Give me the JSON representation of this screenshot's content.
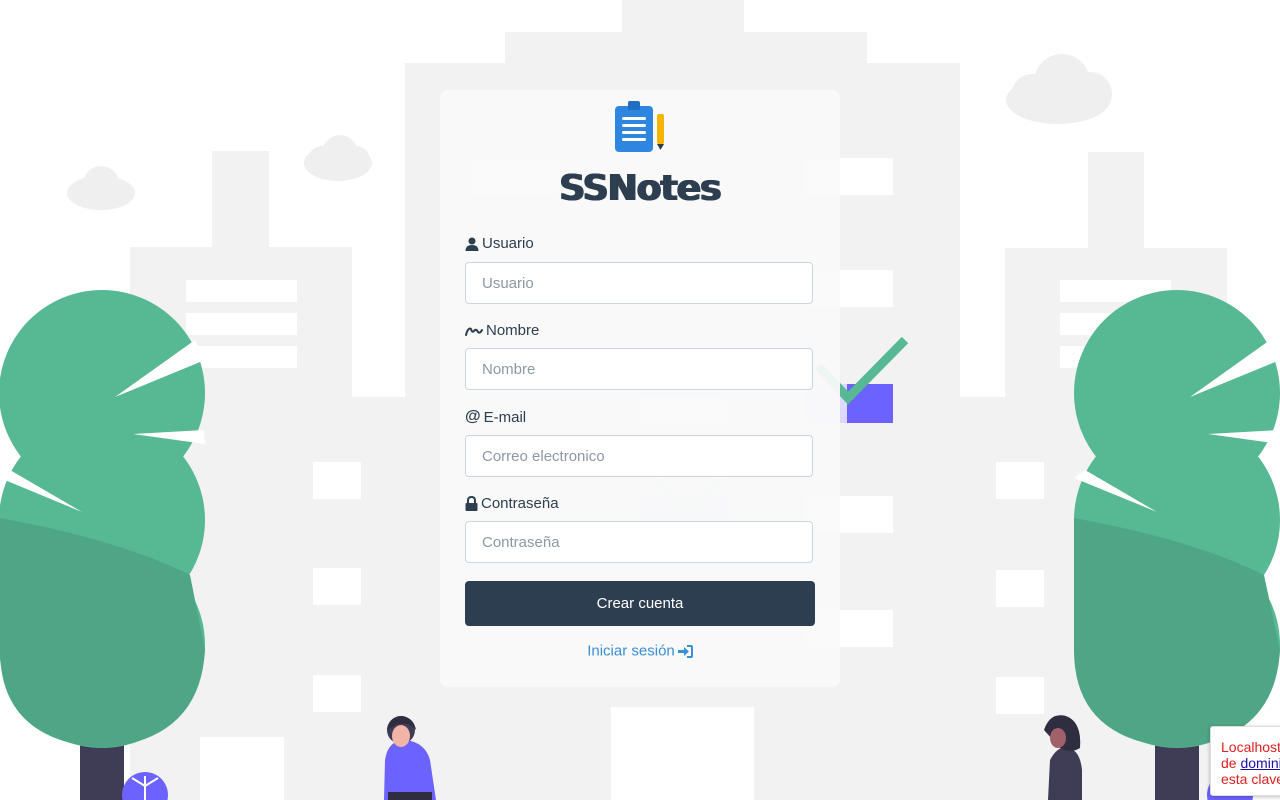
{
  "brand": {
    "name": "SSNotes",
    "logo_icon": "clipboard-pencil-icon"
  },
  "form": {
    "username": {
      "label": "Usuario",
      "placeholder": "Usuario",
      "icon": "user-icon"
    },
    "name": {
      "label": "Nombre",
      "placeholder": "Nombre",
      "icon": "signature-icon"
    },
    "email": {
      "label": "E-mail",
      "placeholder": "Correo electronico",
      "icon": "at-icon"
    },
    "password": {
      "label": "Contraseña",
      "placeholder": "Contraseña",
      "icon": "lock-icon"
    },
    "submit_label": "Crear cuenta",
    "login_link": "Iniciar sesión",
    "login_icon": "sign-in-icon"
  },
  "notice": {
    "line1": "Localhost",
    "line2_prefix": "de ",
    "line2_link": "dominio",
    "line3": "esta clave"
  },
  "colors": {
    "primary": "#2d3e50",
    "link": "#3a8fd6",
    "tree": "#57b894",
    "accent": "#6c63ff"
  }
}
